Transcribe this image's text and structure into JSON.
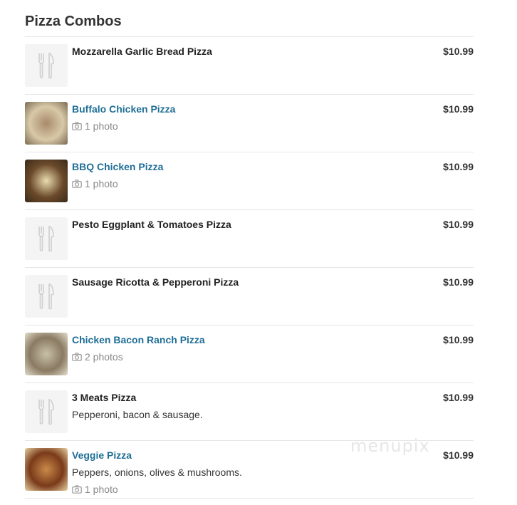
{
  "section": {
    "title": "Pizza Combos"
  },
  "items": [
    {
      "name": "Mozzarella Garlic Bread Pizza",
      "price": "$10.99",
      "has_photo": false,
      "linked": false,
      "description": "",
      "photos_label": ""
    },
    {
      "name": "Buffalo Chicken Pizza",
      "price": "$10.99",
      "has_photo": true,
      "linked": true,
      "description": "",
      "photos_label": "1 photo",
      "thumb_colors": [
        "#a88a6a",
        "#d8c9a8",
        "#7a6a52"
      ]
    },
    {
      "name": "BBQ Chicken Pizza",
      "price": "$10.99",
      "has_photo": true,
      "linked": true,
      "description": "",
      "photos_label": "1 photo",
      "thumb_colors": [
        "#e9dcb0",
        "#6b4a2a",
        "#3a2a1a"
      ]
    },
    {
      "name": "Pesto Eggplant & Tomatoes Pizza",
      "price": "$10.99",
      "has_photo": false,
      "linked": false,
      "description": "",
      "photos_label": ""
    },
    {
      "name": "Sausage Ricotta & Pepperoni Pizza",
      "price": "$10.99",
      "has_photo": false,
      "linked": false,
      "description": "",
      "photos_label": ""
    },
    {
      "name": "Chicken Bacon Ranch Pizza",
      "price": "$10.99",
      "has_photo": true,
      "linked": true,
      "description": "",
      "photos_label": "2 photos",
      "thumb_colors": [
        "#c9c0a8",
        "#8a7a62",
        "#e2dccc"
      ]
    },
    {
      "name": "3 Meats Pizza",
      "price": "$10.99",
      "has_photo": false,
      "linked": false,
      "description": "Pepperoni, bacon & sausage.",
      "photos_label": ""
    },
    {
      "name": "Veggie Pizza",
      "price": "$10.99",
      "has_photo": true,
      "linked": true,
      "description": "Peppers, onions, olives & mushrooms.",
      "photos_label": "1 photo",
      "thumb_colors": [
        "#c98a4a",
        "#7a3a1a",
        "#e8d2a0"
      ]
    }
  ],
  "watermark": "menupix",
  "colors": {
    "link": "#1f6e96",
    "divider": "#e6e6e6",
    "muted": "#888888"
  }
}
